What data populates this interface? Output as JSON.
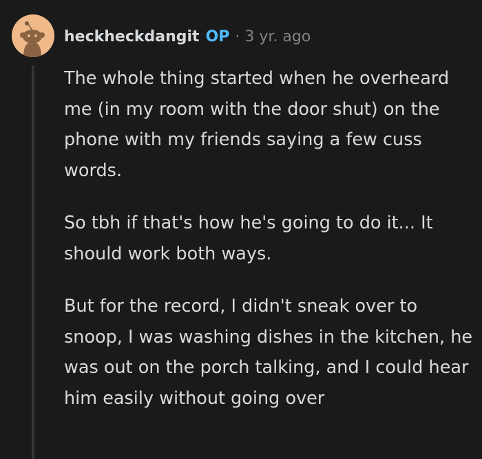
{
  "comment": {
    "author": "heckheckdangit",
    "op_badge": "OP",
    "separator": "·",
    "timestamp": "3 yr. ago",
    "avatar_icon": "snoo-avatar-icon",
    "paragraphs": [
      "The whole thing started when he overheard me (in my room with the door shut) on the phone with my friends saying a few cuss words.",
      "So tbh if that's how he's going to do it... It should work both ways.",
      "But for the record, I didn't sneak over to snoop, I was washing dishes in the kitchen, he was out on the porch talking, and I could hear him easily without going over"
    ]
  },
  "colors": {
    "background": "#1a1a1b",
    "text": "#d7dadc",
    "meta": "#818384",
    "op_badge": "#4fbcff",
    "avatar_bg": "#f0b98a",
    "thread_line": "#343536"
  }
}
